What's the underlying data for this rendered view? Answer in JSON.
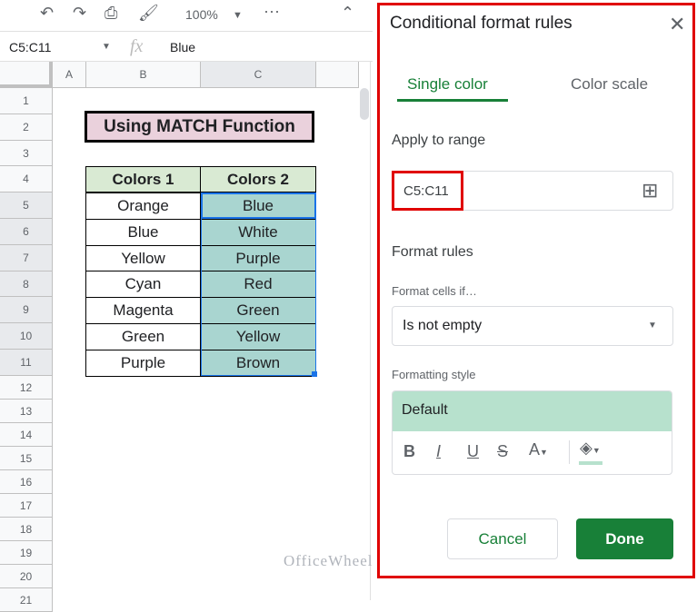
{
  "toolbar": {
    "zoom": "100%",
    "icons": [
      "undo-icon",
      "redo-icon",
      "print-icon",
      "paint-format-icon",
      "more-icon",
      "collapse-icon"
    ]
  },
  "formula_bar": {
    "name_box": "C5:C11",
    "fx": "fx",
    "value": "Blue"
  },
  "columns": [
    "A",
    "B",
    "C"
  ],
  "rows": [
    "1",
    "2",
    "3",
    "4",
    "5",
    "6",
    "7",
    "8",
    "9",
    "10",
    "11",
    "12",
    "13",
    "14",
    "15",
    "16",
    "17",
    "18",
    "19",
    "20",
    "21"
  ],
  "sheet": {
    "title": "Using MATCH Function",
    "headers": [
      "Colors 1",
      "Colors 2"
    ],
    "data": [
      [
        "Orange",
        "Blue"
      ],
      [
        "Blue",
        "White"
      ],
      [
        "Yellow",
        "Purple"
      ],
      [
        "Cyan",
        "Red"
      ],
      [
        "Magenta",
        "Green"
      ],
      [
        "Green",
        "Yellow"
      ],
      [
        "Purple",
        "Brown"
      ]
    ]
  },
  "panel": {
    "title": "Conditional format rules",
    "tabs": [
      "Single color",
      "Color scale"
    ],
    "apply_label": "Apply to range",
    "range": "C5:C11",
    "format_rules": "Format cells if…",
    "format_rules_heading": "Format rules",
    "condition": "Is not empty",
    "style_label": "Formatting style",
    "style_value": "Default",
    "cancel": "Cancel",
    "done": "Done"
  },
  "colors": {
    "accent": "#188038",
    "highlight": "#a9d5d0",
    "header": "#d9ead3",
    "title_bg": "#ead1dc",
    "style_bg": "#b7e1cd"
  },
  "watermark": "OfficeWheel"
}
